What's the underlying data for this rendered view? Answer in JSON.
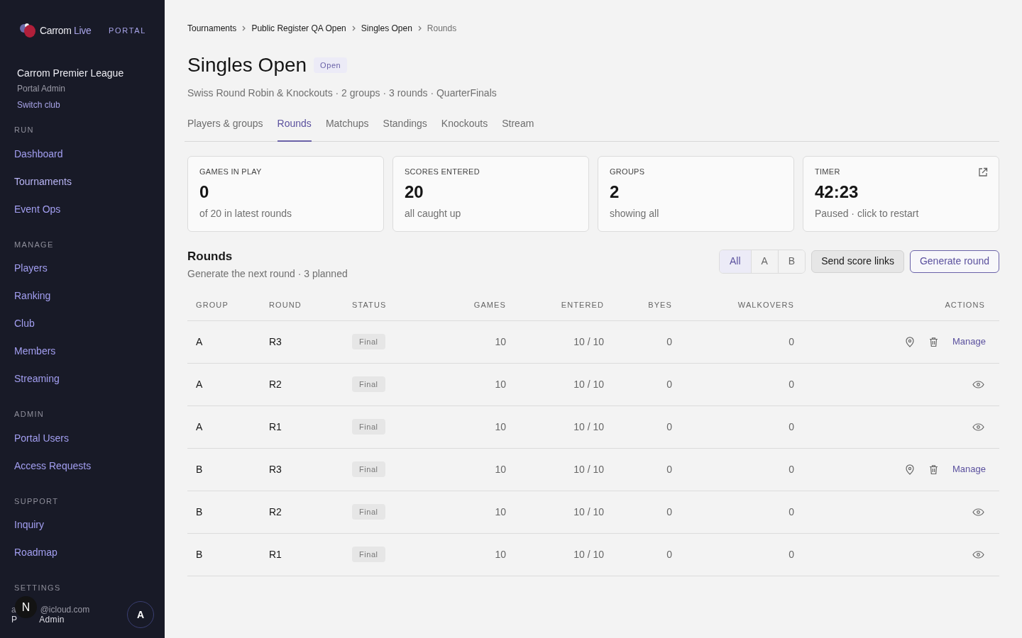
{
  "sidebar": {
    "brand": {
      "name": "Carrom",
      "accent": "Live",
      "tag": "PORTAL"
    },
    "club": {
      "name": "Carrom Premier League",
      "role": "Portal Admin",
      "switch": "Switch club"
    },
    "sections": [
      {
        "title": "RUN",
        "items": [
          {
            "label": "Dashboard",
            "selected": false
          },
          {
            "label": "Tournaments",
            "selected": true
          },
          {
            "label": "Event Ops",
            "selected": false
          }
        ]
      },
      {
        "title": "MANAGE",
        "items": [
          {
            "label": "Players",
            "selected": false
          },
          {
            "label": "Ranking",
            "selected": false
          },
          {
            "label": "Club",
            "selected": false
          },
          {
            "label": "Members",
            "selected": false
          },
          {
            "label": "Streaming",
            "selected": false
          }
        ]
      },
      {
        "title": "ADMIN",
        "items": [
          {
            "label": "Portal Users",
            "selected": false
          },
          {
            "label": "Access Requests",
            "selected": false
          }
        ]
      },
      {
        "title": "SUPPORT",
        "items": [
          {
            "label": "Inquiry",
            "selected": false
          },
          {
            "label": "Roadmap",
            "selected": false
          }
        ]
      },
      {
        "title": "SETTINGS"
      }
    ],
    "user": {
      "email_start": "a",
      "email_end": "@icloud.com",
      "role_start": "P",
      "role_end": "Admin",
      "overlay_badge": "N",
      "avatar": "A"
    }
  },
  "breadcrumbs": [
    "Tournaments",
    "Public Register QA Open",
    "Singles Open",
    "Rounds"
  ],
  "title": "Singles Open",
  "status_badge": "Open",
  "subtitle": "Swiss Round Robin & Knockouts · 2 groups · 3 rounds · QuarterFinals",
  "tabs": [
    {
      "label": "Players & groups",
      "selected": false
    },
    {
      "label": "Rounds",
      "selected": true
    },
    {
      "label": "Matchups",
      "selected": false
    },
    {
      "label": "Standings",
      "selected": false
    },
    {
      "label": "Knockouts",
      "selected": false
    },
    {
      "label": "Stream",
      "selected": false
    }
  ],
  "stats": [
    {
      "label": "GAMES IN PLAY",
      "value": "0",
      "note": "of 20 in latest rounds",
      "external": false
    },
    {
      "label": "SCORES ENTERED",
      "value": "20",
      "note": "all caught up",
      "external": false
    },
    {
      "label": "GROUPS",
      "value": "2",
      "note": "showing all",
      "external": false
    },
    {
      "label": "TIMER",
      "value": "42:23",
      "note": "Paused · click to restart",
      "external": true
    }
  ],
  "rounds": {
    "title": "Rounds",
    "subtitle": "Generate the next round · 3 planned",
    "filters": [
      {
        "label": "All",
        "selected": true
      },
      {
        "label": "A",
        "selected": false
      },
      {
        "label": "B",
        "selected": false
      }
    ],
    "buttons": [
      "Send score links",
      "Generate round"
    ],
    "columns": [
      "GROUP",
      "ROUND",
      "STATUS",
      "GAMES",
      "ENTERED",
      "BYES",
      "WALKOVERS",
      "ACTIONS"
    ],
    "rows": [
      {
        "group": "A",
        "round": "R3",
        "status": "Final",
        "games": "10",
        "entered": "10 / 10",
        "byes": "0",
        "walkovers": "0",
        "kind": "manage",
        "action": "Manage"
      },
      {
        "group": "A",
        "round": "R2",
        "status": "Final",
        "games": "10",
        "entered": "10 / 10",
        "byes": "0",
        "walkovers": "0",
        "kind": "view"
      },
      {
        "group": "A",
        "round": "R1",
        "status": "Final",
        "games": "10",
        "entered": "10 / 10",
        "byes": "0",
        "walkovers": "0",
        "kind": "view"
      },
      {
        "group": "B",
        "round": "R3",
        "status": "Final",
        "games": "10",
        "entered": "10 / 10",
        "byes": "0",
        "walkovers": "0",
        "kind": "manage",
        "action": "Manage"
      },
      {
        "group": "B",
        "round": "R2",
        "status": "Final",
        "games": "10",
        "entered": "10 / 10",
        "byes": "0",
        "walkovers": "0",
        "kind": "view"
      },
      {
        "group": "B",
        "round": "R1",
        "status": "Final",
        "games": "10",
        "entered": "10 / 10",
        "byes": "0",
        "walkovers": "0",
        "kind": "view"
      }
    ]
  }
}
